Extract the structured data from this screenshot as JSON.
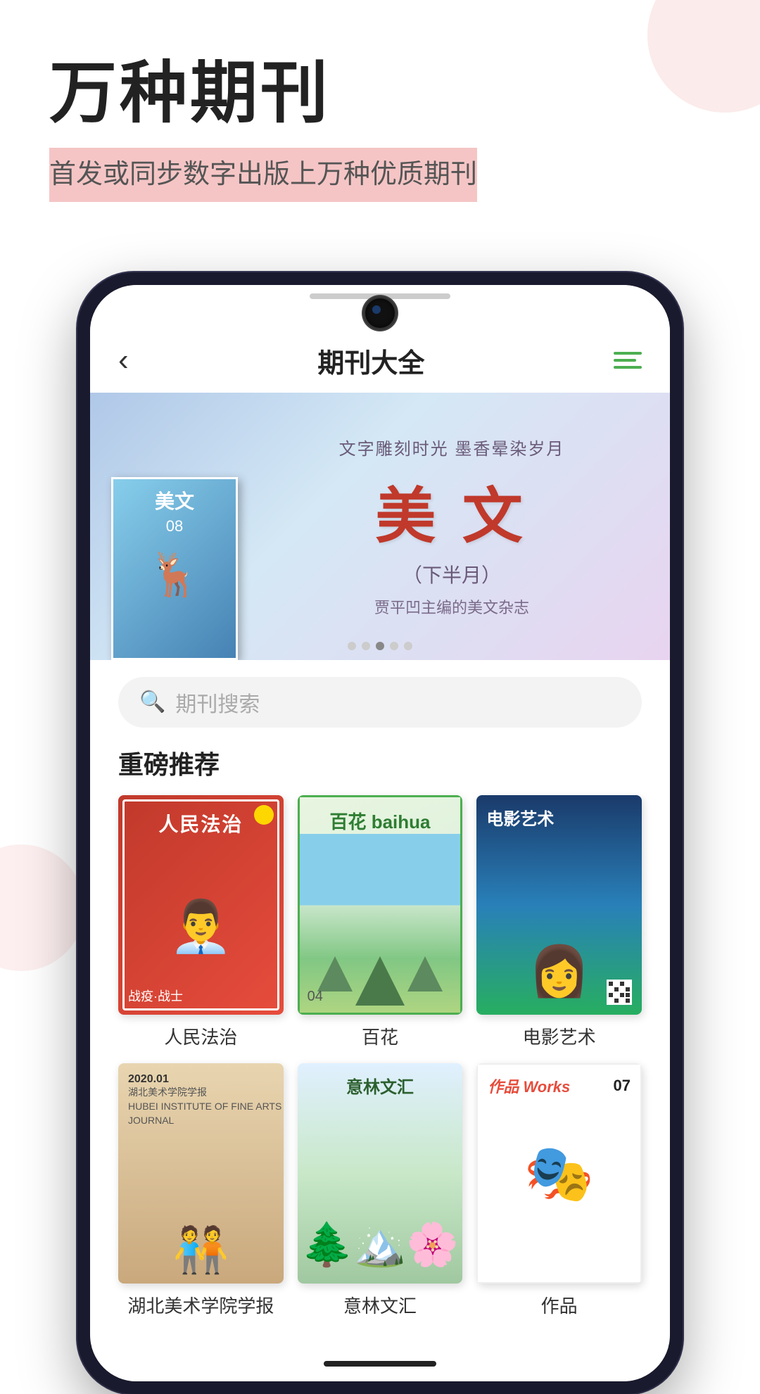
{
  "page": {
    "background_color": "#ffffff"
  },
  "hero": {
    "title": "万种期刊",
    "subtitle": "首发或同步数字出版上万种优质期刊"
  },
  "app": {
    "header": {
      "title": "期刊大全",
      "back_label": "‹",
      "menu_label": "menu"
    },
    "banner": {
      "tagline": "文字雕刻时光 墨香晕染岁月",
      "magazine_name_cn": "美文",
      "magazine_subtitle": "（下半月）",
      "magazine_desc": "贾平凹主编的美文杂志",
      "issue": "08",
      "dots": [
        false,
        false,
        true,
        false,
        false
      ]
    },
    "search": {
      "placeholder": "期刊搜索"
    },
    "section_featured": {
      "title": "重磅推荐"
    },
    "magazines": [
      {
        "id": "rmfz",
        "name": "人民法治",
        "cover_type": "rmfz"
      },
      {
        "id": "baihua",
        "name": "百花",
        "cover_type": "baihua"
      },
      {
        "id": "dyys",
        "name": "电影艺术",
        "cover_type": "dyys"
      },
      {
        "id": "hbmsxy",
        "name": "湖北美术学院学报",
        "cover_type": "hbmsxy"
      },
      {
        "id": "yilin",
        "name": "意林文汇",
        "cover_type": "yilin"
      },
      {
        "id": "zuopin",
        "name": "作品",
        "cover_type": "zuopin",
        "issue": "07"
      }
    ]
  }
}
